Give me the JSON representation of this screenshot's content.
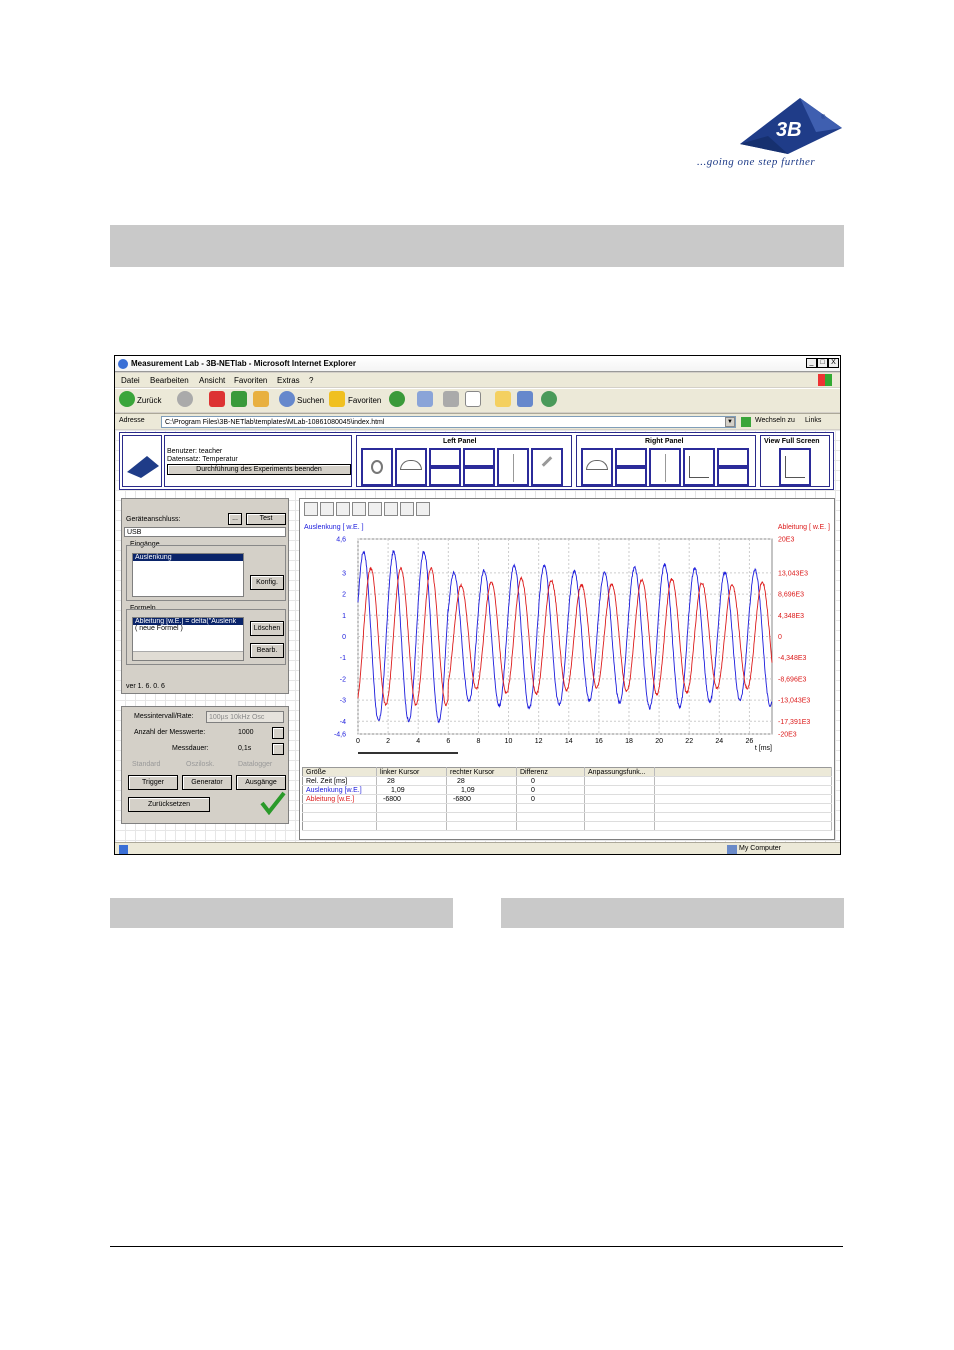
{
  "logo": {
    "mark": "3B",
    "reg": "®",
    "tagline": "...going one step further"
  },
  "window": {
    "title": "Measurement Lab - 3B-NETlab - Microsoft Internet Explorer",
    "controls": [
      "_",
      "□",
      "X"
    ],
    "menu": [
      "Datei",
      "Bearbeiten",
      "Ansicht",
      "Favoriten",
      "Extras",
      "?"
    ],
    "toolbar": {
      "back": "Zurück",
      "search": "Suchen",
      "favorites": "Favoriten"
    },
    "address": {
      "label": "Adresse",
      "value": "C:\\Program Files\\3B-NETlab\\templates\\MLab-10861080045\\index.html",
      "go": "Wechseln zu",
      "links": "Links"
    },
    "status": {
      "zone": "My Computer"
    }
  },
  "app_header": {
    "user": "Benutzer: teacher",
    "dataset": "Datensatz: Temperatur",
    "end_button": "Durchführung des Experiments beenden",
    "left_panel": "Left Panel",
    "right_panel": "Right Panel",
    "full_screen": "View Full Screen"
  },
  "config": {
    "device_label": "Geräteanschluss:",
    "device_btn": "...",
    "test_btn": "Test",
    "device_value": "USB",
    "inputs_label": "Eingänge",
    "inputs": [
      "Auslenkung"
    ],
    "konfig_btn": "Konfig.",
    "formulas_label": "Formeln",
    "formulas": [
      "Ableitung [w.E.] = delta(\"Auslenk",
      "( neue Formel )"
    ],
    "delete_btn": "Löschen",
    "edit_btn": "Bearb.",
    "version": "ver 1. 6. 0. 6"
  },
  "measure": {
    "interval_label": "Messintervall/Rate:",
    "interval_value": "100µs 10kHz Osc",
    "count_label": "Anzahl der Messwerte:",
    "count_value": "1000",
    "duration_label": "Messdauer:",
    "duration_value": "0,1s",
    "modes": [
      "Standard",
      "Oszilosk.",
      "Datalogger"
    ],
    "trigger_btn": "Trigger",
    "generator_btn": "Generator",
    "outputs_btn": "Ausgänge",
    "reset_btn": "Zurücksetzen"
  },
  "chart_data": {
    "type": "line",
    "title": "",
    "ylabel_left": "Auslenkung [ w.E. ]",
    "ylabel_right": "Ableitung [ w.E. ]",
    "xlabel": "t [ms]",
    "x_ticks": [
      0,
      2,
      4,
      6,
      8,
      10,
      12,
      14,
      16,
      18,
      20,
      22,
      24,
      26
    ],
    "y_left_ticks": [
      "4,6",
      "3",
      "2",
      "1",
      "0",
      "-1",
      "-2",
      "-3",
      "-4",
      "-4,6"
    ],
    "y_right_ticks": [
      "20E3",
      "13,043E3",
      "8,696E3",
      "4,348E3",
      "0",
      "-4,348E3",
      "-8,696E3",
      "-13,043E3",
      "-17,391E3",
      "-20E3"
    ],
    "xlim": [
      0,
      27.5
    ],
    "ylim_left": [
      -4.6,
      4.6
    ],
    "ylim_right": [
      -20000,
      20000
    ],
    "grid": true,
    "series": [
      {
        "name": "Auslenkung",
        "color": "#1a1adc",
        "amplitude": 4.0,
        "period_ms": 2.0,
        "phase": 0.4
      },
      {
        "name": "Ableitung",
        "color": "#dc1a1a",
        "amplitude": 14000,
        "period_ms": 2.0,
        "phase": -1.1
      }
    ]
  },
  "table": {
    "headers": [
      "Größe",
      "linker Kursor",
      "rechter Kursor",
      "Differenz",
      "Anpassungsfunk..."
    ],
    "rows": [
      [
        "Rel. Zeit [ms]",
        "28",
        "28",
        "0",
        ""
      ],
      [
        "Auslenkung [w.E.]",
        "1,09",
        "1,09",
        "0",
        ""
      ],
      [
        "Ableitung [w.E.]",
        "-6800",
        "-6800",
        "0",
        ""
      ]
    ]
  }
}
